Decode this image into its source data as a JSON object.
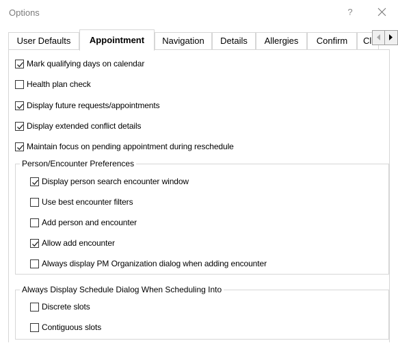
{
  "window": {
    "title": "Options",
    "help_label": "?"
  },
  "tabs": [
    {
      "label": "User Defaults"
    },
    {
      "label": "Appointment"
    },
    {
      "label": "Navigation"
    },
    {
      "label": "Details"
    },
    {
      "label": "Allergies"
    },
    {
      "label": "Confirm"
    },
    {
      "label": "Cl"
    }
  ],
  "active_tab": "Appointment",
  "options": [
    {
      "label": "Mark qualifying days on calendar",
      "checked": true
    },
    {
      "label": "Health plan check",
      "checked": false
    },
    {
      "label": "Display future requests/appointments",
      "checked": true
    },
    {
      "label": "Display extended conflict details",
      "checked": true
    },
    {
      "label": "Maintain focus on pending appointment during reschedule",
      "checked": true
    }
  ],
  "person_group": {
    "title": "Person/Encounter Preferences",
    "items": [
      {
        "label": "Display person search encounter window",
        "checked": true
      },
      {
        "label": "Use best encounter filters",
        "checked": false
      },
      {
        "label": "Add person and encounter",
        "checked": false
      },
      {
        "label": "Allow add encounter",
        "checked": true
      },
      {
        "label": "Always display PM Organization dialog when adding encounter",
        "checked": false
      }
    ]
  },
  "schedule_group": {
    "title": "Always Display Schedule Dialog When Scheduling Into",
    "items": [
      {
        "label": "Discrete slots",
        "checked": false
      },
      {
        "label": "Contiguous slots",
        "checked": false
      }
    ]
  }
}
